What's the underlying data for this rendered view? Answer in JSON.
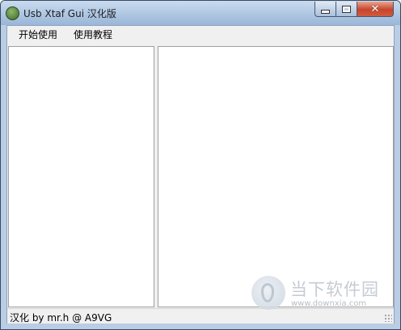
{
  "window": {
    "title": "Usb Xtaf Gui 汉化版",
    "close_glyph": "✕"
  },
  "menu": {
    "items": [
      {
        "label": "开始使用"
      },
      {
        "label": "使用教程"
      }
    ]
  },
  "statusbar": {
    "text": "汉化 by mr.h @ A9VG"
  },
  "watermark": {
    "name": "当下软件园",
    "url": "www.downxia.com"
  },
  "colors": {
    "titlebar": "#9ab6d8",
    "close_button": "#c7452c",
    "client_bg": "#f0f0f0",
    "pane_bg": "#ffffff"
  }
}
